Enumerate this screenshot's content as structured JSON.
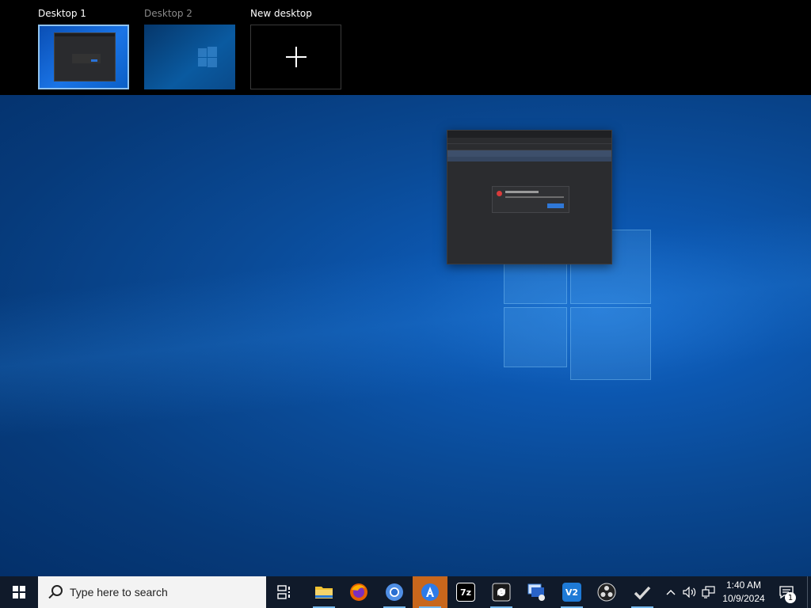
{
  "task_view": {
    "desktops": [
      {
        "label": "Desktop 1",
        "selected": true
      },
      {
        "label": "Desktop 2",
        "selected": false
      },
      {
        "label": "New desktop",
        "selected": false
      }
    ]
  },
  "taskbar": {
    "search_placeholder": "Type here to search",
    "apps": [
      {
        "name": "File Explorer",
        "icon": "folder-icon"
      },
      {
        "name": "Firefox",
        "icon": "firefox-icon"
      },
      {
        "name": "Chromium",
        "icon": "chromium-icon"
      },
      {
        "name": "Store app",
        "icon": "store-icon",
        "active": true
      },
      {
        "name": "7-Zip",
        "icon": "7zip-icon",
        "text": "7z"
      },
      {
        "name": "Sync app",
        "icon": "sync-icon"
      },
      {
        "name": "Remote desktop",
        "icon": "remote-desktop-icon"
      },
      {
        "name": "VS Code",
        "icon": "vscode-icon",
        "text": "V2"
      },
      {
        "name": "OBS",
        "icon": "obs-icon"
      },
      {
        "name": "Tasks",
        "icon": "checkmark-icon"
      }
    ],
    "clock": {
      "time": "1:40 AM",
      "date": "10/9/2024"
    },
    "notification_count": "1"
  },
  "colors": {
    "taskbar_bg": "#101a2a",
    "accent_active": "#c8671c",
    "selection_border": "#8fc3f0"
  }
}
